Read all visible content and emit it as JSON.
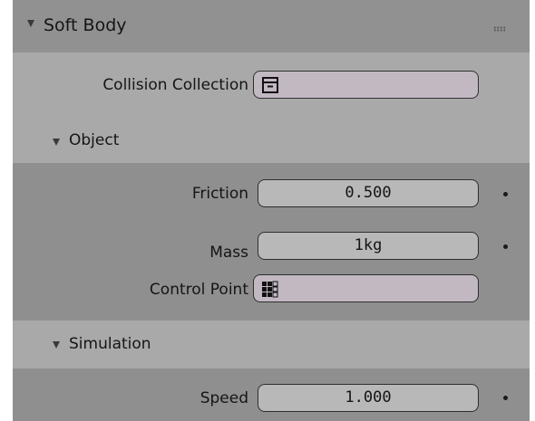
{
  "panel": {
    "title": "Soft Body",
    "grip_icon": "drag-handle-icon"
  },
  "collision": {
    "label": "Collision Collection",
    "value": "",
    "icon": "collection-icon"
  },
  "object_section": {
    "title": "Object",
    "friction": {
      "label": "Friction",
      "value": "0.500"
    },
    "mass": {
      "label": "Mass",
      "value": "1kg"
    },
    "control_point": {
      "label": "Control Point",
      "value": "",
      "icon": "vertex-group-icon"
    }
  },
  "simulation_section": {
    "title": "Simulation",
    "speed": {
      "label": "Speed",
      "value": "1.000"
    }
  },
  "colors": {
    "panel_bg": "#a9a9a9",
    "header_bg": "#919191",
    "section_bg": "#8f8f8f",
    "object_field_bg": "#c2b8c2",
    "number_field_bg": "#b8b8b8"
  }
}
